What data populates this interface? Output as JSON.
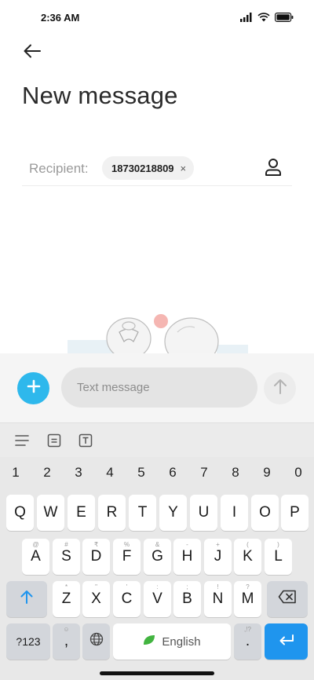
{
  "status_bar": {
    "time": "2:36 AM",
    "icons": [
      "signal-icon",
      "wifi-icon",
      "battery-icon"
    ]
  },
  "header": {
    "back_icon": "arrow-left-icon",
    "title": "New message"
  },
  "recipient": {
    "label": "Recipient:",
    "chips": [
      {
        "number": "18730218809",
        "remove_glyph": "×"
      }
    ],
    "contact_icon": "person-icon"
  },
  "compose": {
    "placeholder": "Text message",
    "attach_icon": "plus-icon",
    "send_icon": "arrow-up-icon",
    "accent_color": "#2eb8ec"
  },
  "keyboard_toolbar": {
    "tools": [
      "menu-icon",
      "clipboard-icon",
      "text-icon"
    ]
  },
  "keyboard": {
    "numbers": [
      "1",
      "2",
      "3",
      "4",
      "5",
      "6",
      "7",
      "8",
      "9",
      "0"
    ],
    "row1": [
      "Q",
      "W",
      "E",
      "R",
      "T",
      "Y",
      "U",
      "I",
      "O",
      "P"
    ],
    "row2": [
      {
        "k": "A",
        "h": "@"
      },
      {
        "k": "S",
        "h": "#"
      },
      {
        "k": "D",
        "h": "₹"
      },
      {
        "k": "F",
        "h": "%"
      },
      {
        "k": "G",
        "h": "&"
      },
      {
        "k": "H",
        "h": "-"
      },
      {
        "k": "J",
        "h": "+"
      },
      {
        "k": "K",
        "h": "("
      },
      {
        "k": "L",
        "h": ")"
      }
    ],
    "row3": [
      {
        "k": "Z",
        "h": "*"
      },
      {
        "k": "X",
        "h": "\""
      },
      {
        "k": "C",
        "h": "'"
      },
      {
        "k": "V",
        "h": ":"
      },
      {
        "k": "B",
        "h": ";"
      },
      {
        "k": "N",
        "h": "!"
      },
      {
        "k": "M",
        "h": "?"
      }
    ],
    "symbols_label": "?123",
    "comma": ",",
    "comma_hint": "☺",
    "space_label": "English",
    "period": ".",
    "period_hint": ",!?",
    "enter_color": "#1f95ee"
  }
}
